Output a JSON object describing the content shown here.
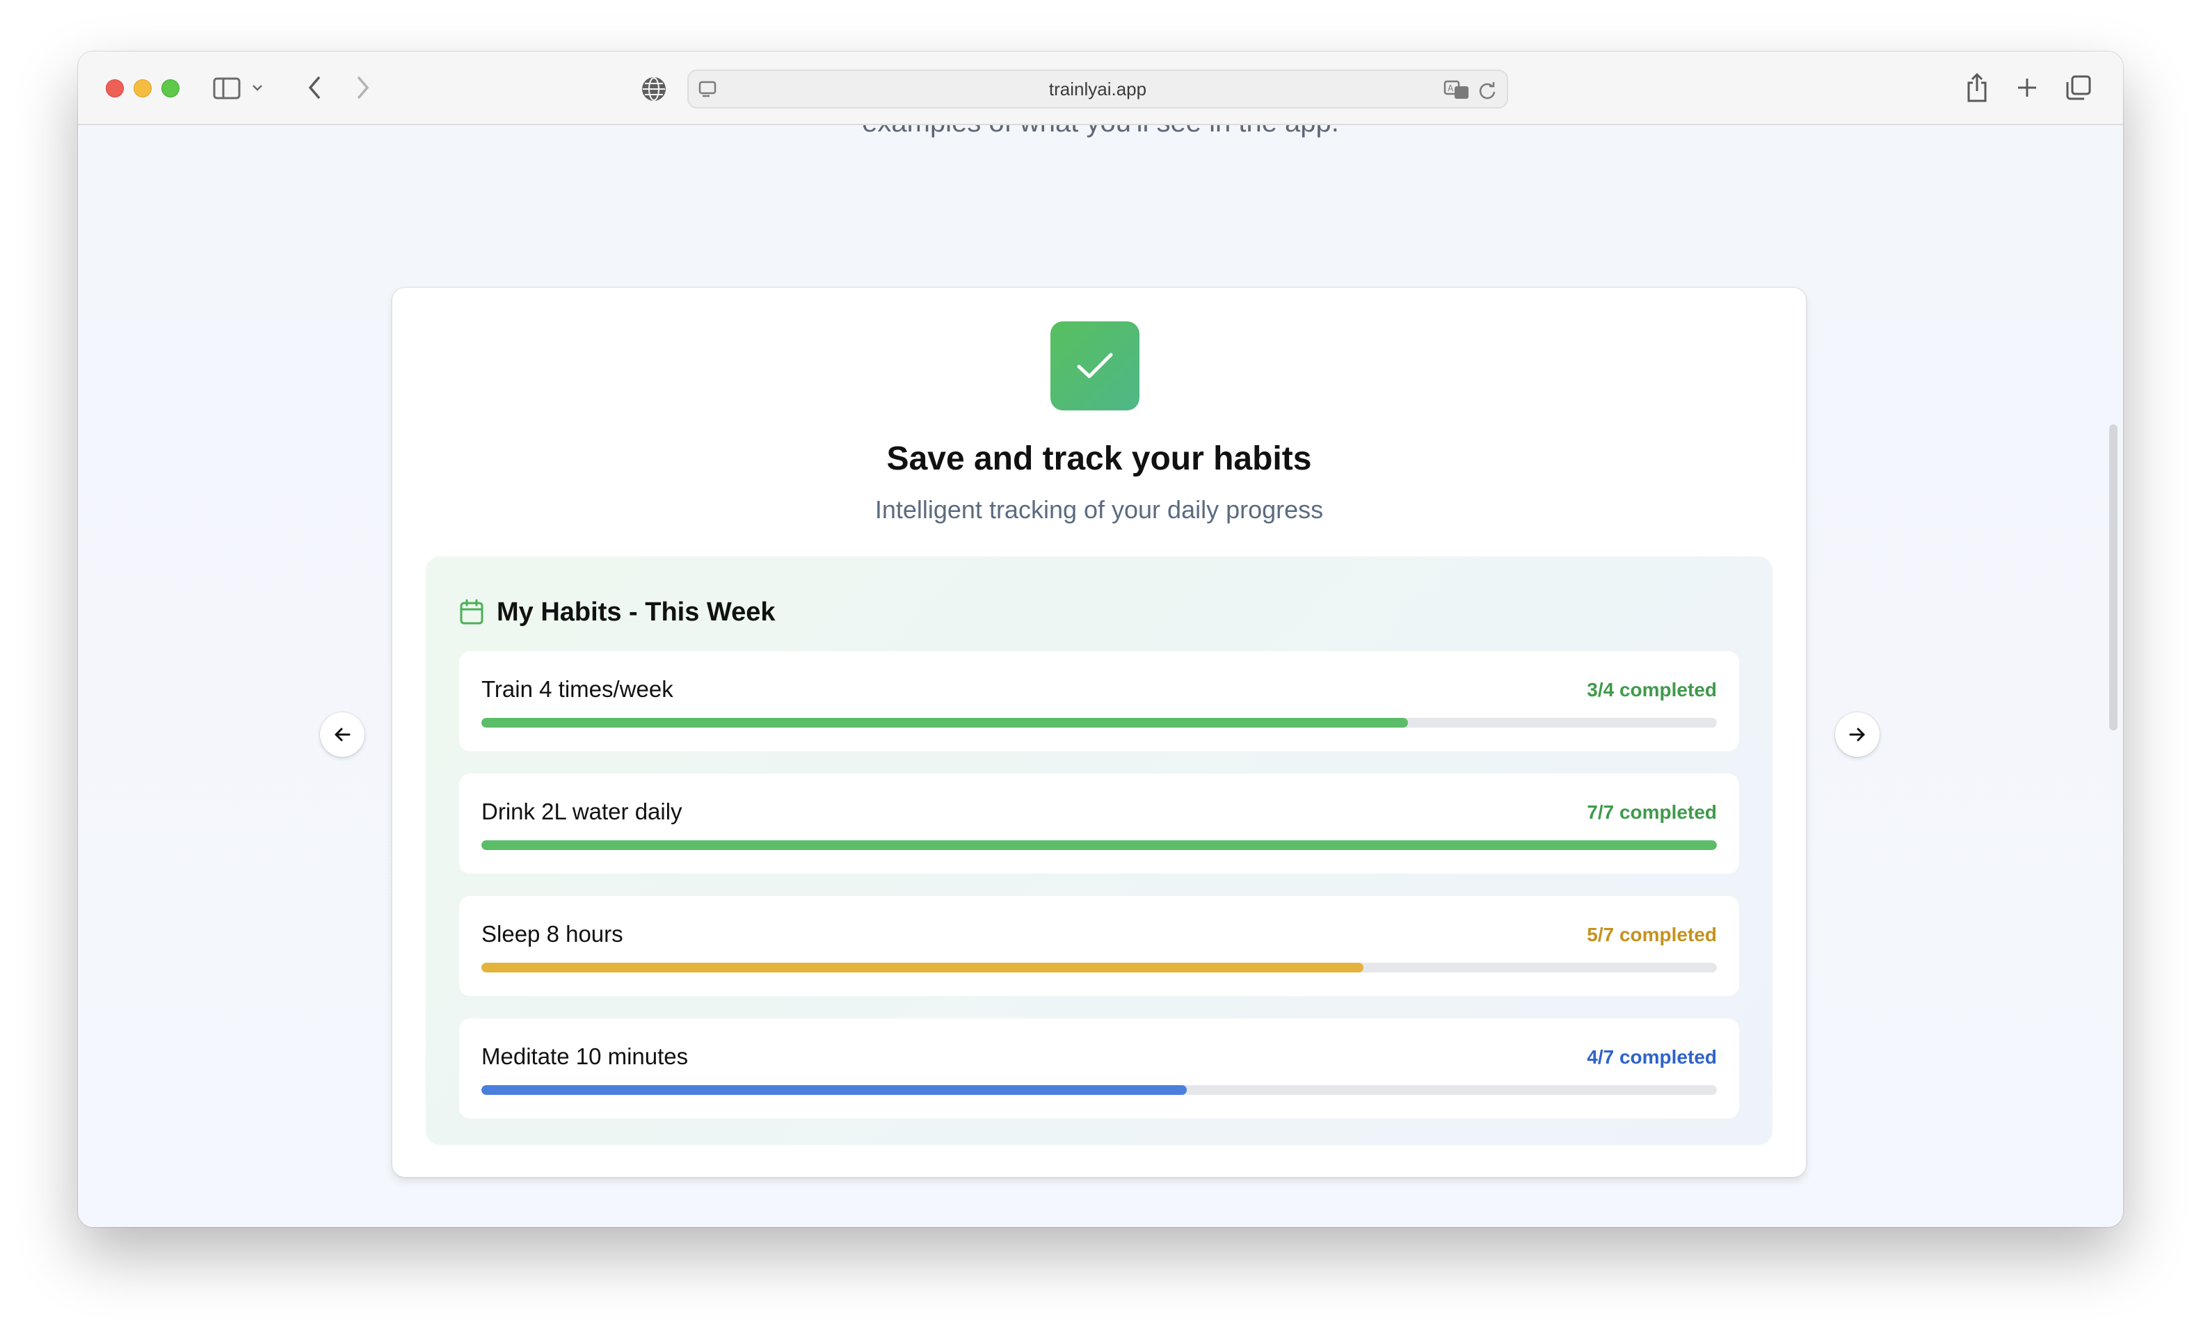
{
  "browser": {
    "url": "trainlyai.app",
    "buttons": [
      "close",
      "minimize",
      "zoom",
      "sidebar",
      "back",
      "forward",
      "share",
      "new-tab",
      "tab-overview"
    ]
  },
  "page": {
    "clipped_intro": "examples of what you'll see in the app.",
    "card": {
      "title": "Save and track your habits",
      "subtitle": "Intelligent tracking of your daily progress",
      "icon": "check-icon"
    },
    "panel": {
      "title": "My Habits - This Week",
      "icon": "calendar-icon",
      "habits": [
        {
          "name": "Train 4 times/week",
          "status": "3/4 completed",
          "progress": 0.75,
          "color": "#5cbd69",
          "status_color": "#3f9a4b"
        },
        {
          "name": "Drink 2L water daily",
          "status": "7/7 completed",
          "progress": 1.0,
          "color": "#5cbd69",
          "status_color": "#3f9a4b"
        },
        {
          "name": "Sleep 8 hours",
          "status": "5/7 completed",
          "progress": 0.714,
          "color": "#e3b33b",
          "status_color": "#c4921f"
        },
        {
          "name": "Meditate 10 minutes",
          "status": "4/7 completed",
          "progress": 0.571,
          "color": "#4a7fdd",
          "status_color": "#2f63c8"
        }
      ]
    }
  },
  "colors": {
    "accent_green": "#58bf5f",
    "background": "#f3f6fb"
  }
}
